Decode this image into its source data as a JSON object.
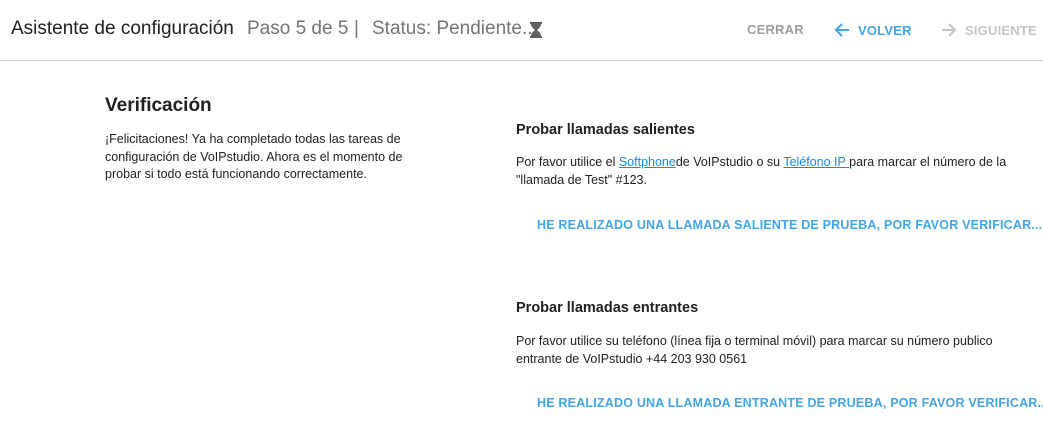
{
  "header": {
    "title": "Asistente de configuración",
    "step": "Paso 5 de 5",
    "separator": "|",
    "status": "Status: Pendiente...",
    "close_label": "CERRAR",
    "back_label": "VOLVER",
    "next_label": "SIGUIENTE"
  },
  "left": {
    "heading": "Verificación",
    "text": "¡Felicitaciones! Ya ha completado todas las tareas de configuración de VoIPstudio. Ahora es el momento de probar si todo está funcionando correctamente."
  },
  "outgoing": {
    "heading": "Probar llamadas salientes",
    "text_1": "Por favor utilice el ",
    "link_softphone": "Softphone",
    "text_2": "de VoIPstudio o su ",
    "link_phone": "Teléfono IP ",
    "text_3": "para marcar el número de la \"llamada de Test\" #123.",
    "button": "HE REALIZADO UNA LLAMADA SALIENTE DE PRUEBA, POR FAVOR VERIFICAR..."
  },
  "incoming": {
    "heading": "Probar llamadas entrantes",
    "text": "Por favor utilice su teléfono (línea fija o terminal móvil) para marcar su número publico entrante de VoIPstudio +44 203 930 0561",
    "button": "HE REALIZADO UNA LLAMADA ENTRANTE DE PRUEBA, POR FAVOR VERIFICAR..."
  },
  "colors": {
    "accent": "#42a5e8",
    "link": "#1e88e5",
    "muted": "#757575",
    "disabled": "#c6c6c6"
  },
  "icons": {
    "status": "hourglass-icon",
    "back": "arrow-left-icon",
    "next": "arrow-right-icon"
  }
}
